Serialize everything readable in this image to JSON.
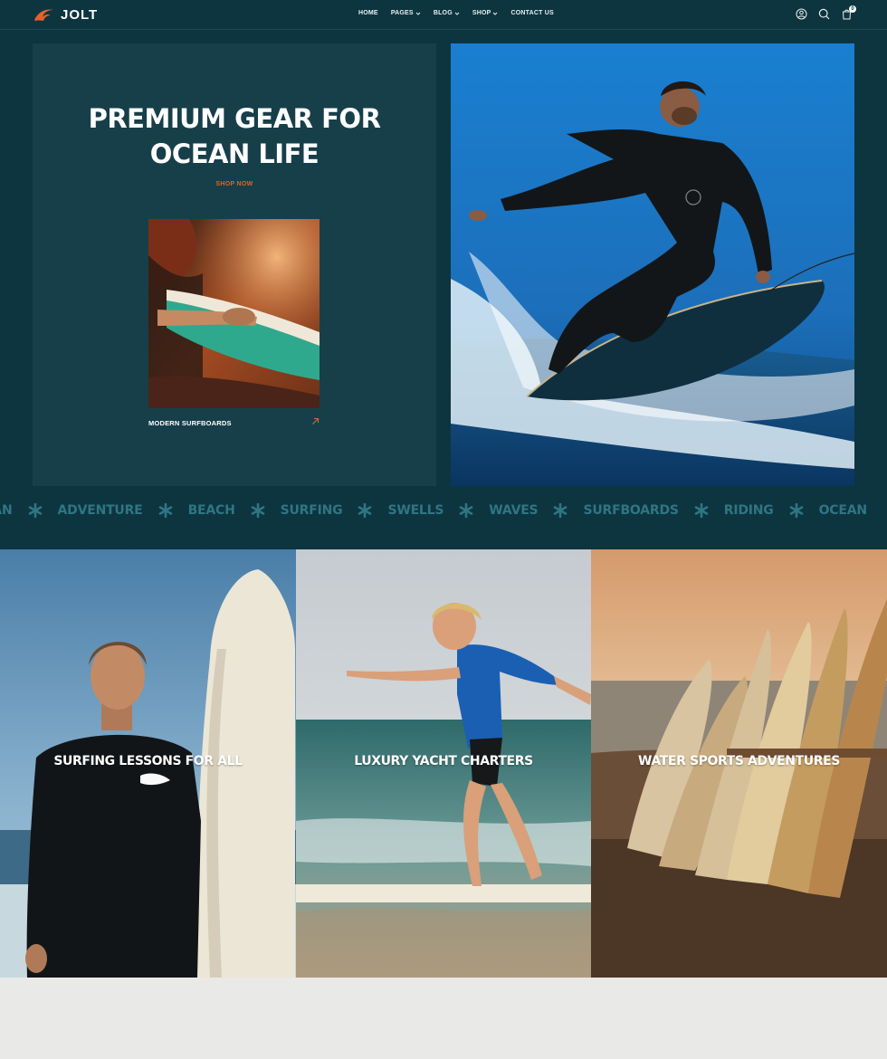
{
  "brand": {
    "name": "JOLT",
    "accent": "#e2622a",
    "background": "#0d3540",
    "panel": "#173f4a"
  },
  "nav": [
    {
      "label": "HOME",
      "dropdown": false
    },
    {
      "label": "PAGES",
      "dropdown": true
    },
    {
      "label": "BLOG",
      "dropdown": true
    },
    {
      "label": "SHOP",
      "dropdown": true
    },
    {
      "label": "CONTACT US",
      "dropdown": false
    }
  ],
  "header_icons": [
    "account-icon",
    "search-icon",
    "cart-icon"
  ],
  "cart": {
    "count": "0"
  },
  "hero": {
    "title_line1": "PREMIUM GEAR FOR",
    "title_line2": "OCEAN LIFE",
    "cta": "SHOP NOW",
    "card_label": "MODERN SURFBOARDS"
  },
  "marquee": {
    "items": [
      "EAN",
      "ADVENTURE",
      "BEACH",
      "SURFING",
      "SWELLS",
      "WAVES",
      "SURFBOARDS",
      "RIDING",
      "OCEAN"
    ]
  },
  "tiles": [
    {
      "label": "SURFING LESSONS FOR ALL"
    },
    {
      "label": "LUXURY YACHT CHARTERS"
    },
    {
      "label": "WATER SPORTS ADVENTURES"
    }
  ]
}
